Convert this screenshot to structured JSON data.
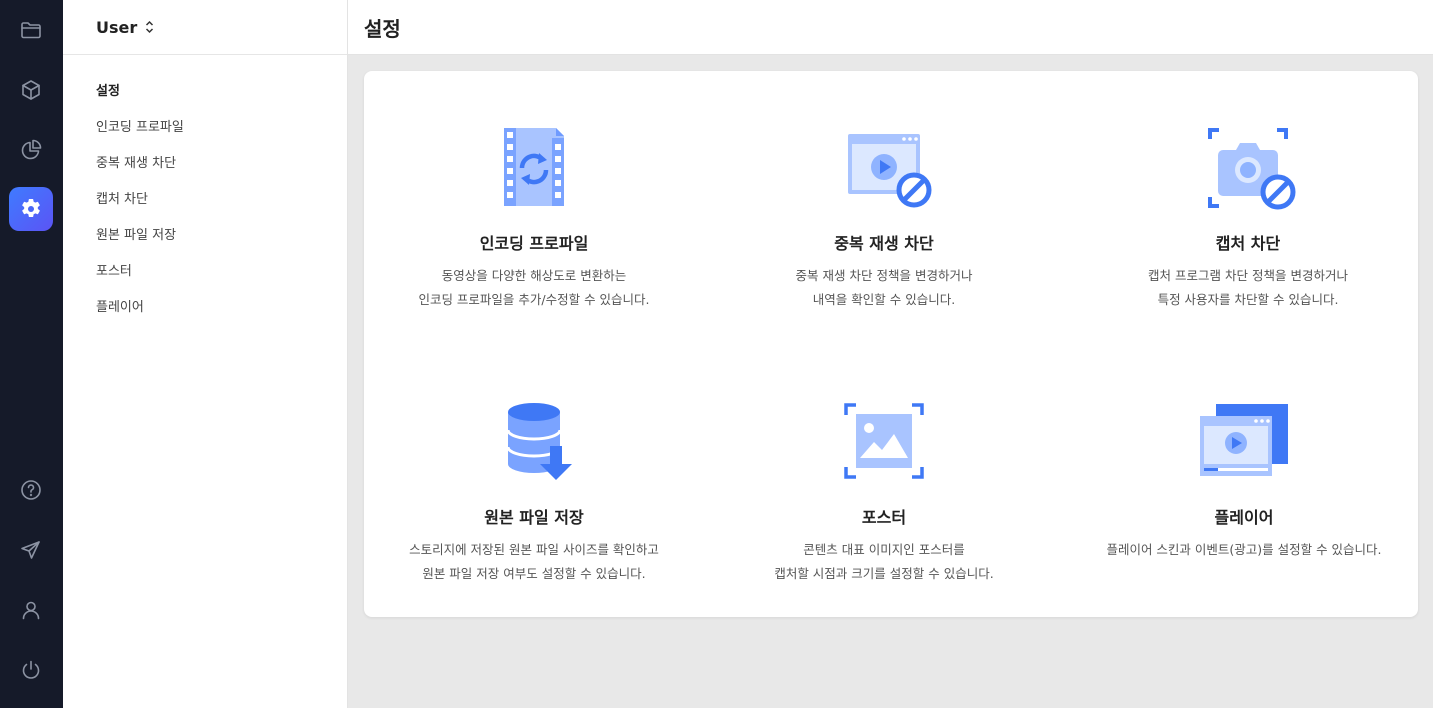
{
  "rail": {
    "items": [
      {
        "name": "folder-icon"
      },
      {
        "name": "cube-icon"
      },
      {
        "name": "pie-chart-icon"
      },
      {
        "name": "gear-icon",
        "active": true
      },
      {
        "name": "help-icon"
      },
      {
        "name": "send-icon"
      },
      {
        "name": "user-icon"
      },
      {
        "name": "power-icon"
      }
    ],
    "accent": "#4a6cf7"
  },
  "sidebar": {
    "user_label": "User",
    "items": [
      {
        "label": "설정",
        "active": true
      },
      {
        "label": "인코딩 프로파일"
      },
      {
        "label": "중복 재생 차단"
      },
      {
        "label": "캡처 차단"
      },
      {
        "label": "원본 파일 저장"
      },
      {
        "label": "포스터"
      },
      {
        "label": "플레이어"
      }
    ]
  },
  "header": {
    "title": "설정"
  },
  "tiles": [
    {
      "icon": "encoding-profile-icon",
      "title": "인코딩 프로파일",
      "desc": [
        "동영상을 다양한 해상도로 변환하는",
        "인코딩 프로파일을 추가/수정할 수 있습니다."
      ]
    },
    {
      "icon": "duplicate-play-block-icon",
      "title": "중복 재생 차단",
      "desc": [
        "중복 재생 차단 정책을 변경하거나",
        "내역을 확인할 수 있습니다."
      ]
    },
    {
      "icon": "capture-block-icon",
      "title": "캡처 차단",
      "desc": [
        "캡처 프로그램 차단 정책을 변경하거나",
        "특정 사용자를 차단할 수 있습니다."
      ]
    },
    {
      "icon": "original-file-storage-icon",
      "title": "원본 파일 저장",
      "desc": [
        "스토리지에 저장된 원본 파일 사이즈를 확인하고",
        "원본 파일 저장 여부도 설정할 수 있습니다."
      ]
    },
    {
      "icon": "poster-icon",
      "title": "포스터",
      "desc": [
        "콘텐츠 대표 이미지인 포스터를",
        "캡처할 시점과 크기를 설정할 수 있습니다."
      ]
    },
    {
      "icon": "player-icon",
      "title": "플레이어",
      "desc": [
        "플레이어 스킨과 이벤트(광고)를 설정할 수 있습니다."
      ]
    }
  ],
  "colors": {
    "icon_light": "#a9c4ff",
    "icon_mid": "#6f9bff",
    "icon_dark": "#3f78f5"
  }
}
